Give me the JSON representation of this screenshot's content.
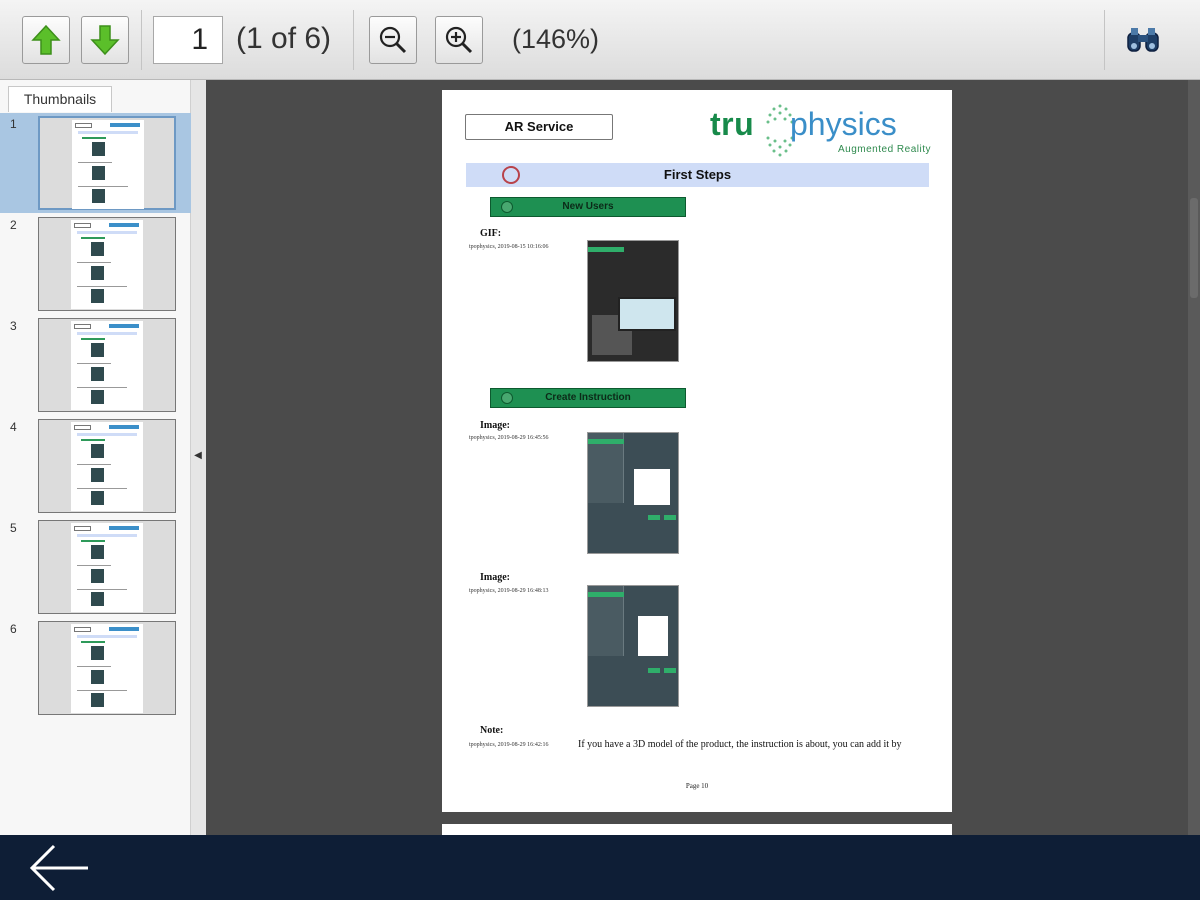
{
  "toolbar": {
    "prev_page_icon": "arrow-up-icon",
    "next_page_icon": "arrow-down-icon",
    "page_value": "1",
    "page_count": "(1 of 6)",
    "zoom_out_icon": "zoom-out-icon",
    "zoom_in_icon": "zoom-in-icon",
    "zoom_level": "(146%)",
    "find_icon": "binoculars-icon",
    "arrow_color": "#5bbf2a"
  },
  "sidebar": {
    "tab_label": "Thumbnails",
    "selected_page": 1,
    "thumbnails": [
      {
        "label": "1"
      },
      {
        "label": "2"
      },
      {
        "label": "3"
      },
      {
        "label": "4"
      },
      {
        "label": "5"
      },
      {
        "label": "6"
      }
    ]
  },
  "document": {
    "service_label": "AR Service",
    "logo": {
      "tru": "tru",
      "physics": "physics",
      "tagline": "Augmented Reality"
    },
    "section_title": "First Steps",
    "subsections": [
      {
        "title": "New Users"
      },
      {
        "title": "Create Instruction"
      }
    ],
    "entries": [
      {
        "label": "GIF:",
        "meta": "tpophysics, 2019-08-15 10:16:06"
      },
      {
        "label": "Image:",
        "meta": "tpophysics, 2019-08-29 16:45:56"
      },
      {
        "label": "Image:",
        "meta": "tpophysics, 2019-08-29 16:48:13"
      },
      {
        "label": "Note:",
        "meta": "tpophysics, 2019-08-29 16:42:16",
        "text": "If you have a 3D model of the product, the instruction is about, you can add it by"
      }
    ],
    "footer": "Page 10"
  },
  "bottom_nav": {
    "back_icon": "back-arrow-icon"
  }
}
